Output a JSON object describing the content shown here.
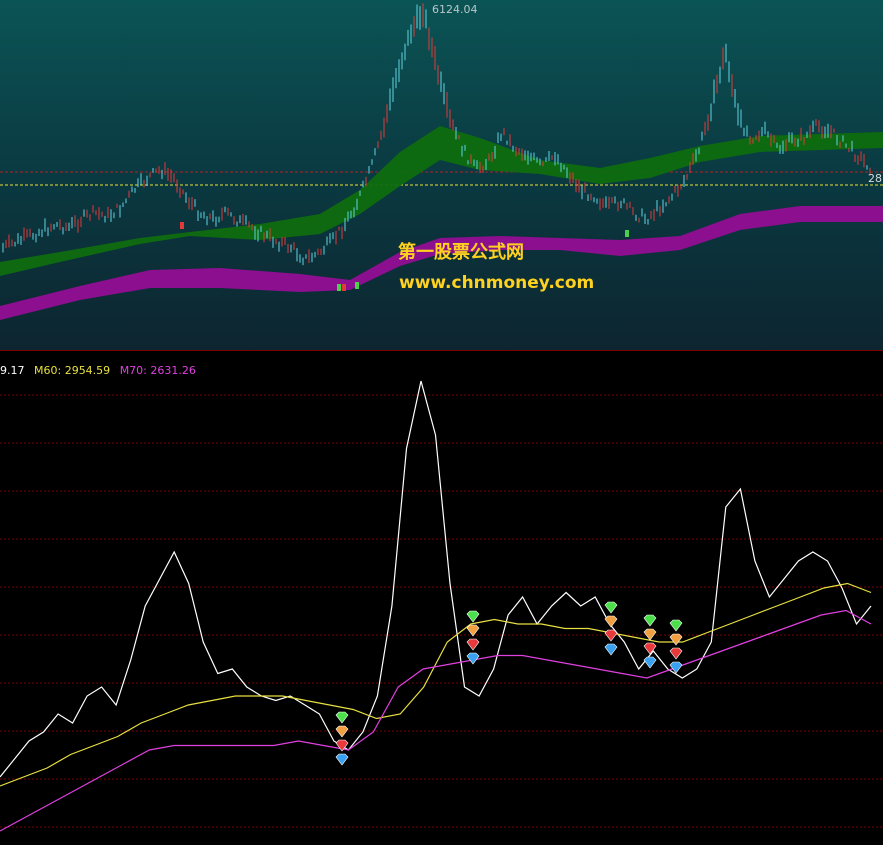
{
  "watermark": {
    "site_name": "第一股票公式网",
    "url": "www.chnmoney.com"
  },
  "top_chart": {
    "peak_label": "6124.04",
    "right_price_label": "28",
    "colors": {
      "band_upper": "#0f6d0f",
      "band_lower": "#8b0f8f",
      "candle_up": "#e23a3a",
      "candle_down": "#5fd3e0",
      "hline_red": "#b02020",
      "hline_yellow": "#e8e23a"
    }
  },
  "legend": {
    "m_first": "9.17",
    "m60": "M60: 2954.59",
    "m70": "M70: 2631.26",
    "colors": {
      "white": "#ffffff",
      "m60": "#e8e040",
      "m70": "#e040e0"
    }
  },
  "chart_data": [
    {
      "type": "line",
      "panel": "price",
      "title": "",
      "annotations": [
        "6124.04"
      ],
      "series": [
        {
          "name": "",
          "values": [
            0.18,
            0.2,
            0.22,
            0.24,
            0.26,
            0.25,
            0.28,
            0.3,
            0.29,
            0.32,
            0.38,
            0.42,
            0.45,
            0.42,
            0.35,
            0.3,
            0.28,
            0.3,
            0.27,
            0.25,
            0.22,
            0.2,
            0.18,
            0.14,
            0.16,
            0.2,
            0.26,
            0.34,
            0.45,
            0.6,
            0.78,
            0.92,
            1.0,
            0.8,
            0.62,
            0.52,
            0.45,
            0.48,
            0.58,
            0.52,
            0.5,
            0.46,
            0.5,
            0.44,
            0.38,
            0.36,
            0.32,
            0.34,
            0.3,
            0.28,
            0.32,
            0.36,
            0.42,
            0.52,
            0.68,
            0.86,
            0.62,
            0.56,
            0.58,
            0.52,
            0.55,
            0.56,
            0.6,
            0.58,
            0.54,
            0.5,
            0.46
          ]
        }
      ]
    },
    {
      "type": "line",
      "panel": "indicator",
      "series": [
        {
          "name": "",
          "values": [
            0.12,
            0.16,
            0.2,
            0.22,
            0.26,
            0.24,
            0.3,
            0.32,
            0.28,
            0.38,
            0.5,
            0.56,
            0.62,
            0.55,
            0.42,
            0.35,
            0.36,
            0.32,
            0.3,
            0.29,
            0.3,
            0.28,
            0.26,
            0.2,
            0.18,
            0.22,
            0.3,
            0.5,
            0.85,
            1.0,
            0.88,
            0.55,
            0.32,
            0.3,
            0.36,
            0.48,
            0.52,
            0.46,
            0.5,
            0.53,
            0.5,
            0.52,
            0.46,
            0.42,
            0.36,
            0.4,
            0.36,
            0.34,
            0.36,
            0.42,
            0.72,
            0.76,
            0.6,
            0.52,
            0.56,
            0.6,
            0.62,
            0.6,
            0.54,
            0.46,
            0.5
          ]
        },
        {
          "name": "M60",
          "values": [
            0.1,
            0.12,
            0.14,
            0.17,
            0.19,
            0.21,
            0.24,
            0.26,
            0.28,
            0.29,
            0.3,
            0.3,
            0.3,
            0.29,
            0.28,
            0.27,
            0.25,
            0.26,
            0.32,
            0.42,
            0.46,
            0.47,
            0.46,
            0.46,
            0.45,
            0.45,
            0.44,
            0.43,
            0.42,
            0.42,
            0.44,
            0.46,
            0.48,
            0.5,
            0.52,
            0.54,
            0.55,
            0.53
          ]
        },
        {
          "name": "M70",
          "values": [
            0.0,
            0.03,
            0.06,
            0.09,
            0.12,
            0.15,
            0.18,
            0.19,
            0.19,
            0.19,
            0.19,
            0.19,
            0.2,
            0.19,
            0.18,
            0.22,
            0.32,
            0.36,
            0.37,
            0.38,
            0.39,
            0.39,
            0.38,
            0.37,
            0.36,
            0.35,
            0.34,
            0.36,
            0.38,
            0.4,
            0.42,
            0.44,
            0.46,
            0.48,
            0.49,
            0.46
          ]
        }
      ],
      "markers": [
        {
          "group": 1,
          "colors": [
            "green",
            "orange",
            "red",
            "blue"
          ]
        },
        {
          "group": 2,
          "colors": [
            "green",
            "orange",
            "red",
            "blue"
          ]
        },
        {
          "group": 3,
          "colors": [
            "green",
            "orange",
            "red",
            "blue"
          ]
        },
        {
          "group": 4,
          "colors": [
            "green",
            "orange",
            "red",
            "blue"
          ]
        },
        {
          "group": 5,
          "colors": [
            "green",
            "orange",
            "red",
            "blue"
          ]
        }
      ]
    }
  ]
}
